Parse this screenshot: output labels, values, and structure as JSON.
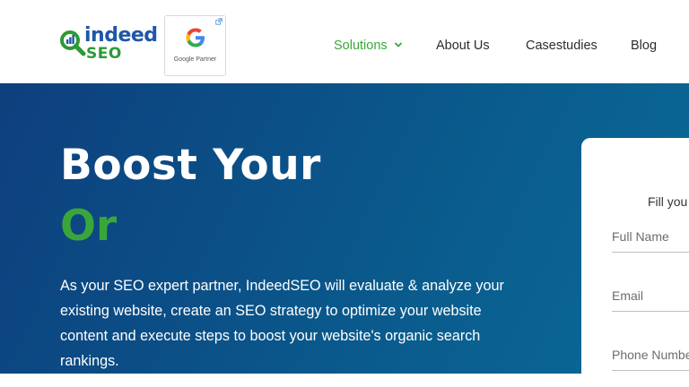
{
  "header": {
    "logo": {
      "brand_top": "indeed",
      "brand_bottom": "SEO"
    },
    "partner_badge": {
      "label": "Google Partner",
      "glyph": "G"
    },
    "nav": {
      "solutions": "Solutions",
      "about": "About Us",
      "casestudies": "Casestudies",
      "blog": "Blog"
    }
  },
  "hero": {
    "headline_line1": "Boost Your",
    "headline_line2": "Or",
    "description": "As your SEO expert partner, IndeedSEO will evaluate & analyze your existing website, create an SEO strategy to optimize your website content and execute steps to boost your website's organic search rankings."
  },
  "form": {
    "intro": "Fill you",
    "full_name_placeholder": "Full Name",
    "email_placeholder": "Email",
    "phone_placeholder": "Phone Numbe"
  },
  "colors": {
    "brand_green": "#3aa63a",
    "brand_blue": "#1f57a8",
    "hero_gradient_start": "#0e3f7e",
    "hero_gradient_end": "#0a6a97"
  }
}
